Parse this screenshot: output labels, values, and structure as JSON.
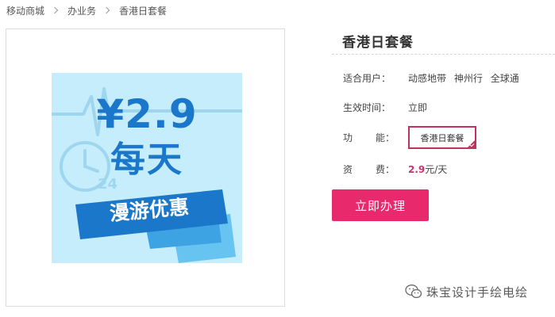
{
  "breadcrumb": [
    "移动商城",
    "办业务",
    "香港日套餐"
  ],
  "promo_image": {
    "price": "¥2.9",
    "daily": "每天",
    "label": "漫游优惠",
    "clock_number": "24",
    "colors": {
      "background": "#c6edfc",
      "text": "#1a77c9",
      "banner": "#1a77c9"
    }
  },
  "product": {
    "title": "香港日套餐",
    "users_label": "适合用户：",
    "users": [
      "动感地带",
      "神州行",
      "全球通"
    ],
    "effective_label": "生效时间：",
    "effective_value": "立即",
    "function_label_1": "功",
    "function_label_2": "能：",
    "function_option": "香港日套餐",
    "fee_label_1": "资",
    "fee_label_2": "费：",
    "fee_amount": "2.9",
    "fee_unit": "元/天",
    "apply_button": "立即办理"
  },
  "watermark": {
    "icon": "wechat-icon",
    "text": "珠宝设计手绘电绘"
  },
  "colors": {
    "accent": "#e8296b",
    "selected_border": "#c2325e",
    "fee_text": "#d0306d"
  }
}
